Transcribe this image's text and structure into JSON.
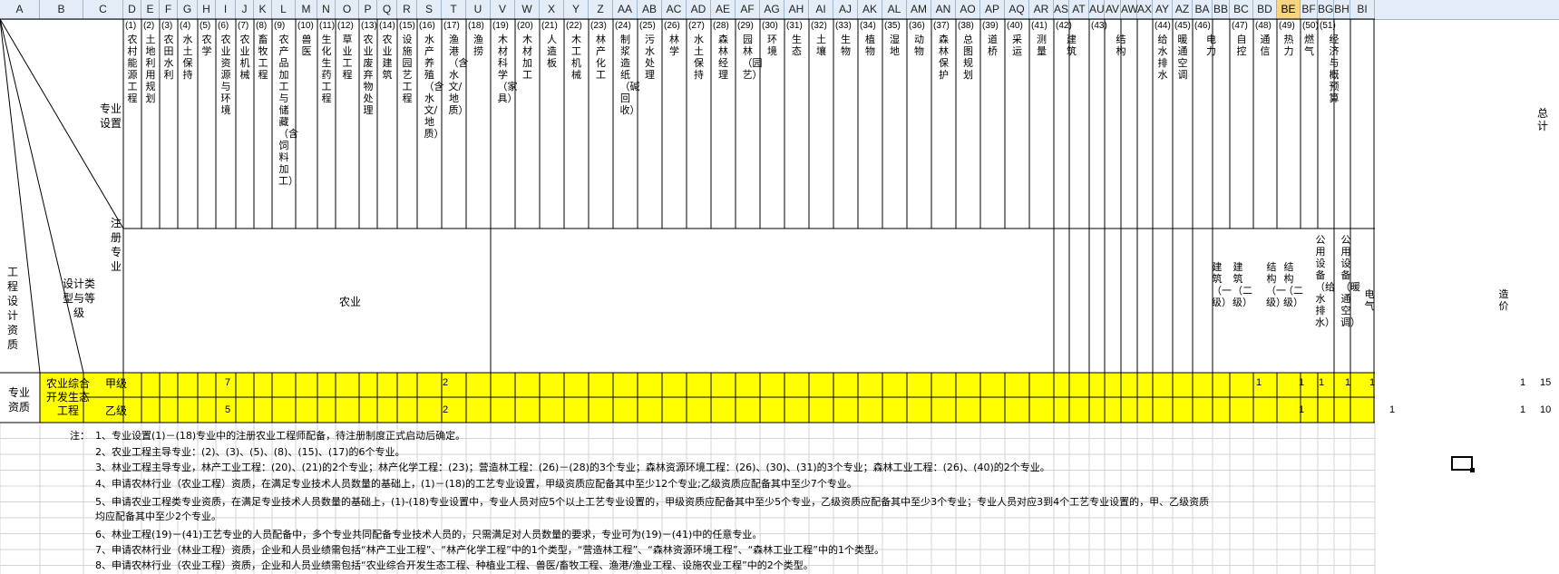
{
  "columns": [
    "A",
    "B",
    "C",
    "D",
    "E",
    "F",
    "G",
    "H",
    "I",
    "J",
    "K",
    "L",
    "M",
    "N",
    "O",
    "P",
    "Q",
    "R",
    "S",
    "T",
    "U",
    "V",
    "W",
    "X",
    "Y",
    "Z",
    "AA",
    "AB",
    "AC",
    "AD",
    "AE",
    "AF",
    "AG",
    "AH",
    "AI",
    "AJ",
    "AK",
    "AL",
    "AM",
    "AN",
    "AO",
    "AP",
    "AQ",
    "AR",
    "AS",
    "AT",
    "AU",
    "AV",
    "AW",
    "AX",
    "AY",
    "AZ",
    "BA",
    "BB",
    "BC",
    "BD",
    "BE",
    "BF",
    "BG",
    "BH",
    "BI"
  ],
  "selected_column": "BE",
  "corner": {
    "zhuanye_shezhi": "专业设置",
    "zhuce_zhuanye": "注册专业",
    "sheji_leixing": "设计类型与等级",
    "gongcheng_sheji_zizhi": "工程设计资质"
  },
  "specialties": [
    {
      "num": "(1)",
      "name": "农村能源工程"
    },
    {
      "num": "(2)",
      "name": "土地利用规划"
    },
    {
      "num": "(3)",
      "name": "农田水利"
    },
    {
      "num": "(4)",
      "name": "水土保持"
    },
    {
      "num": "(5)",
      "name": "农学"
    },
    {
      "num": "(6)",
      "name": "农业资源与环境"
    },
    {
      "num": "(7)",
      "name": "农业机械"
    },
    {
      "num": "(8)",
      "name": "畜牧工程"
    },
    {
      "num": "(9)",
      "name": "农产品加工与储藏（含饲料加工）"
    },
    {
      "num": "(10)",
      "name": "兽医"
    },
    {
      "num": "(11)",
      "name": "生化生药工程"
    },
    {
      "num": "(12)",
      "name": "草业工程"
    },
    {
      "num": "(13)",
      "name": "农业废弃物处理"
    },
    {
      "num": "(14)",
      "name": "农业建筑"
    },
    {
      "num": "(15)",
      "name": "设施园艺工程"
    },
    {
      "num": "(16)",
      "name": "水产养殖（含水文/地质）"
    },
    {
      "num": "(17)",
      "name": "渔港（含水文/地质）"
    },
    {
      "num": "(18)",
      "name": "渔捞"
    },
    {
      "num": "(19)",
      "name": "木材科学（家具）"
    },
    {
      "num": "(20)",
      "name": "木材加工"
    },
    {
      "num": "(21)",
      "name": "人造板"
    },
    {
      "num": "(22)",
      "name": "木工机械"
    },
    {
      "num": "(23)",
      "name": "林产化工"
    },
    {
      "num": "(24)",
      "name": "制浆造纸（碱回收）"
    },
    {
      "num": "(25)",
      "name": "污水处理"
    },
    {
      "num": "(26)",
      "name": "林学"
    },
    {
      "num": "(27)",
      "name": "水土保持"
    },
    {
      "num": "(28)",
      "name": "森林经理"
    },
    {
      "num": "(29)",
      "name": "园林（园艺）"
    },
    {
      "num": "(30)",
      "name": "环境"
    },
    {
      "num": "(31)",
      "name": "生态"
    },
    {
      "num": "(32)",
      "name": "土壤"
    },
    {
      "num": "(33)",
      "name": "生物"
    },
    {
      "num": "(34)",
      "name": "植物"
    },
    {
      "num": "(35)",
      "name": "湿地"
    },
    {
      "num": "(36)",
      "name": "动物"
    },
    {
      "num": "(37)",
      "name": "森林保护"
    },
    {
      "num": "(38)",
      "name": "总图规划"
    },
    {
      "num": "(39)",
      "name": "道桥"
    },
    {
      "num": "(40)",
      "name": "采运"
    },
    {
      "num": "(41)",
      "name": "测量"
    },
    {
      "num": "(42)",
      "name": "建筑"
    },
    {
      "num": "(43)",
      "name": "结构"
    },
    {
      "num": "(44)",
      "name": "给水排水"
    },
    {
      "num": "(45)",
      "name": "暖通空调"
    },
    {
      "num": "(46)",
      "name": "电力"
    },
    {
      "num": "(47)",
      "name": "自控"
    },
    {
      "num": "(48)",
      "name": "通信"
    },
    {
      "num": "(49)",
      "name": "热力"
    },
    {
      "num": "(50)",
      "name": "燃气"
    },
    {
      "num": "(51)",
      "name": "经济与概预算"
    }
  ],
  "total_label": "总计",
  "registered": {
    "agri": "农业",
    "jz1": "建筑（一级）",
    "jz2": "建筑（二级）",
    "jg1": "结构（一级）",
    "jg2": "结构（二级）",
    "gs": "公用设备（给水排水）",
    "nt": "公用设备（暖通空调）",
    "dq": "电气",
    "zj": "造价"
  },
  "rows": {
    "section_label": "专业资质",
    "type_label": "农业综合开发生态工程",
    "jia": {
      "grade": "甲级",
      "a": "7",
      "b": "2",
      "ones": [
        "1",
        "1",
        "1",
        "1",
        "1",
        "1"
      ],
      "total": "15"
    },
    "yi": {
      "grade": "乙级",
      "a": "5",
      "b": "2",
      "ones": [
        "1",
        "1",
        "1"
      ],
      "total": "10"
    }
  },
  "notes": {
    "label": "注：",
    "n1": "1、专业设置(1)－(18)专业中的注册农业工程师配备，待注册制度正式启动后确定。",
    "n2": "2、农业工程主导专业：(2)、(3)、(5)、(8)、(15)、(17)的6个专业。",
    "n3": "3、林业工程主导专业，林产工业工程：(20)、(21)的2个专业；林产化学工程：(23)；营造林工程：(26)－(28)的3个专业；森林资源环境工程：(26)、(30)、(31)的3个专业；森林工业工程：(26)、(40)的2个专业。",
    "n4": "4、申请农林行业（农业工程）资质，在满足专业技术人员数量的基础上，(1)－(18)的工艺专业设置，甲级资质应配备其中至少12个专业;乙级资质应配备其中至少7个专业。",
    "n5": "5、申请农业工程类专业资质，在满足专业技术人员数量的基础上，(1)-(18)专业设置中，专业人员对应5个以上工艺专业设置的，甲级资质应配备其中至少5个专业，乙级资质应配备其中至少3个专业；专业人员对应3到4个工艺专业设置的，甲、乙级资质均应配备其中至少2个专业。",
    "n6": "6、林业工程(19)－(41)工艺专业的人员配备中，多个专业共同配备专业技术人员的，只需满足对人员数量的要求，专业可为(19)－(41)中的任意专业。",
    "n7": "7、申请农林行业（林业工程）资质，企业和人员业绩需包括“林产工业工程”、“林产化学工程”中的1个类型，“营造林工程”、“森林资源环境工程”、“森林工业工程”中的1个类型。",
    "n8": "8、申请农林行业（农业工程）资质，企业和人员业绩需包括“农业综合开发生态工程、种植业工程、兽医/畜牧工程、渔港/渔业工程、设施农业工程”中的2个类型。"
  },
  "colors": {
    "yellow": "#ffff00",
    "grid": "#c0c0c0",
    "header_bg": "#e4ecf7",
    "selected_header": "#f7d47d"
  }
}
